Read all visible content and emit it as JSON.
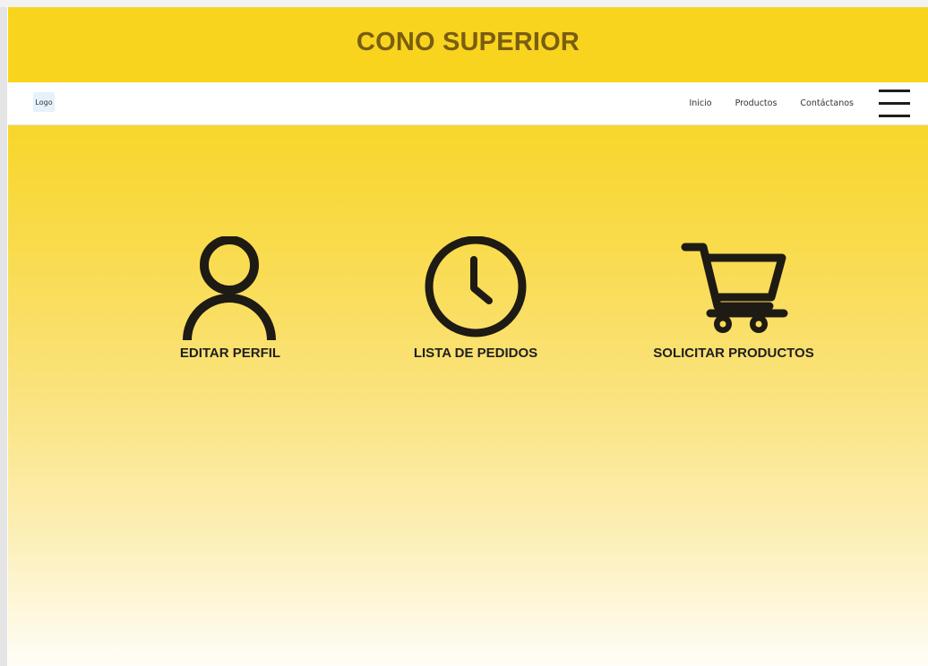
{
  "banner": {
    "title": "CONO SUPERIOR"
  },
  "navbar": {
    "logo_text": "Logo",
    "links": [
      {
        "label": "Inicio"
      },
      {
        "label": "Productos"
      },
      {
        "label": "Contáctanos"
      }
    ],
    "menu_icon": "hamburger-menu-icon"
  },
  "actions": [
    {
      "label": "EDITAR PERFIL",
      "icon": "user-icon"
    },
    {
      "label": "LISTA DE PEDIDOS",
      "icon": "clock-icon"
    },
    {
      "label": "SOLICITAR PRODUCTOS",
      "icon": "shopping-cart-icon"
    }
  ],
  "colors": {
    "banner": "#f8d41e",
    "banner_text": "#7a5d10",
    "gradient_top": "#f8d62a",
    "gradient_bottom": "#fffdf7",
    "icon": "#1e1a14"
  }
}
